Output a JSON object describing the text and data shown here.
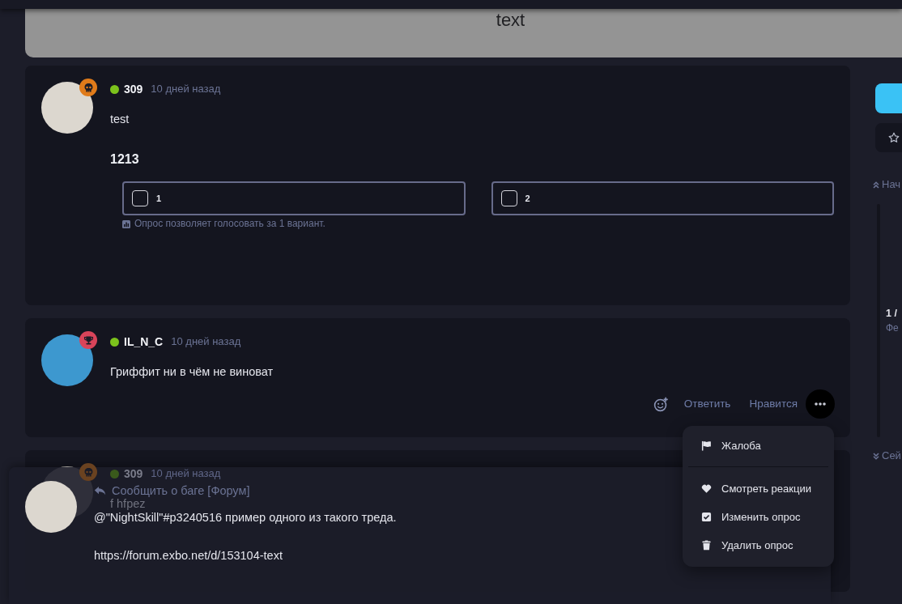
{
  "hero": {
    "title": "text"
  },
  "posts": [
    {
      "user": "309",
      "online": true,
      "avatar": {
        "color": "#dcd7cf"
      },
      "badge": {
        "kind": "skull",
        "color": "#e07b1a"
      },
      "time": "10 дней назад",
      "body": "test",
      "poll": {
        "title": "1213",
        "options": [
          {
            "label": "1",
            "checked": false
          },
          {
            "label": "2",
            "checked": false
          }
        ],
        "note": "Опрос позволяет голосовать за 1 вариант."
      }
    },
    {
      "user": "IL_N_C",
      "online": true,
      "avatar": {
        "color": "#3d98cf"
      },
      "badge": {
        "kind": "trophy",
        "color": "#d9445a"
      },
      "time": "10 дней назад",
      "body": "Гриффит ни в чём не виноват",
      "actions": {
        "reply": "Ответить",
        "like": "Нравится",
        "menu": {
          "open": true,
          "groups": [
            {
              "items": [
                {
                  "kind": "flag",
                  "label": "Жалоба"
                }
              ]
            },
            {
              "items": [
                {
                  "kind": "heart",
                  "label": "Смотреть реакции"
                },
                {
                  "kind": "check",
                  "label": "Изменить опрос"
                },
                {
                  "kind": "trash",
                  "label": "Удалить опрос"
                }
              ]
            }
          ]
        }
      }
    },
    {
      "user": "309",
      "online": true,
      "avatar": {
        "color": "#dcd7cf"
      },
      "badge": {
        "kind": "skull",
        "color": "#6a4220"
      },
      "time": "10 дней назад",
      "body": "f hfpez"
    }
  ],
  "composer": {
    "avatar": {
      "color": "#dcd7cf"
    },
    "reply_to": "Сообщить о баге [Форум]",
    "value": "@\"NightSkill\"#p3240516 пример одного из такого треда.\n\nhttps://forum.exbo.net/d/153104-text"
  },
  "sidebar": {
    "scrubber": {
      "start": "Нач",
      "position": "1 /",
      "date": "Фе",
      "end": "Сей"
    }
  }
}
